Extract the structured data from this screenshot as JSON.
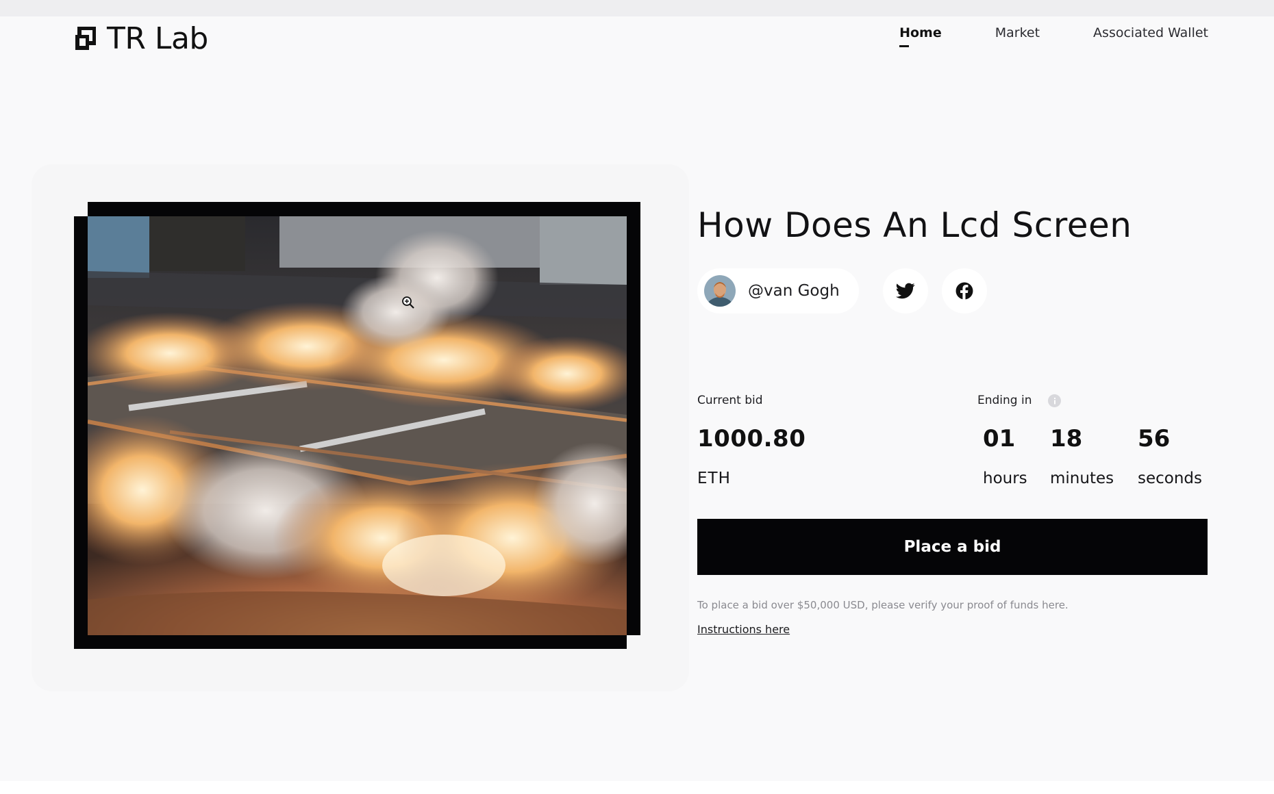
{
  "header": {
    "logo_text": "TR Lab",
    "nav": [
      {
        "label": "Home",
        "active": true
      },
      {
        "label": "Market",
        "active": false
      },
      {
        "label": "Associated Wallet",
        "active": false
      }
    ]
  },
  "artwork": {
    "title": "How Does An Lcd Screen",
    "image_icon": "zoom-in-icon"
  },
  "creator": {
    "handle": "@van Gogh",
    "avatar_icon": "avatar-portrait"
  },
  "social": {
    "twitter_icon": "twitter-icon",
    "facebook_icon": "facebook-icon"
  },
  "auction": {
    "current_bid_label": "Current bid",
    "bid_amount": "1000.80",
    "bid_currency": "ETH",
    "ending_label": "Ending in",
    "countdown": [
      {
        "value": "01",
        "unit": "hours"
      },
      {
        "value": "18",
        "unit": "minutes"
      },
      {
        "value": "56",
        "unit": "seconds"
      }
    ]
  },
  "actions": {
    "place_bid_label": "Place a bid",
    "note": "To place a bid over $50,000 USD, please verify your proof of funds here.",
    "instructions_label": "Instructions here"
  },
  "colors": {
    "background": "#f9f9fa",
    "button": "#050507",
    "text": "#111111"
  }
}
